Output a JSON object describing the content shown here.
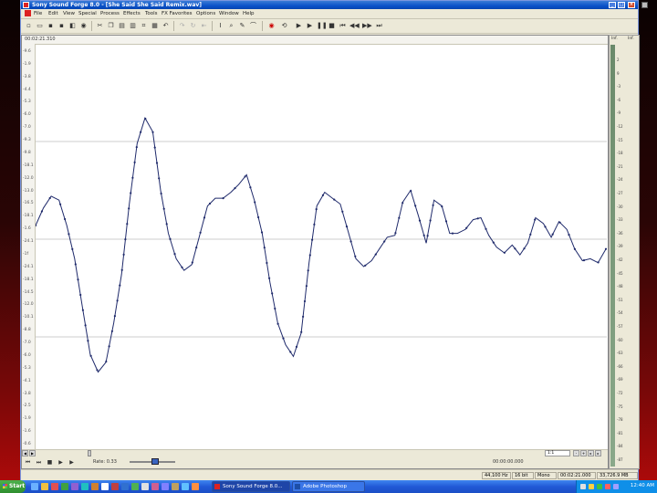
{
  "window": {
    "title": "Sony Sound Forge 8.0 - [She Said She Said Remix.wav]",
    "controls": [
      "_",
      "□",
      "×"
    ]
  },
  "menu": [
    "File",
    "Edit",
    "View",
    "Special",
    "Process",
    "Effects",
    "Tools",
    "FX Favorites",
    "Options",
    "Window",
    "Help"
  ],
  "toolbar_icons": [
    "new-icon",
    "open-icon",
    "save-icon",
    "save-as-icon",
    "render-icon",
    "properties-icon",
    "cut-icon",
    "copy-icon",
    "paste-icon",
    "mix-icon",
    "crop-icon",
    "clear-icon",
    "undo-icon",
    "redo-icon",
    "repeat-icon",
    "trim-icon",
    "edit-tool-icon",
    "magnify-tool-icon",
    "pencil-tool-icon",
    "envelope-tool-icon",
    "record-icon",
    "play-icon",
    "play-all-icon",
    "pause-icon",
    "stop-icon",
    "go-start-icon",
    "rewind-icon",
    "fast-forward-icon",
    "go-end-icon"
  ],
  "doc": {
    "ruler_time": "00:02:21.310",
    "axis_labels": [
      "-9.6",
      "-1.9",
      "-3.8",
      "-4.4",
      "-5.3",
      "-6.0",
      "-7.0",
      "-9.3",
      "-9.8",
      "-18.1",
      "-12.0",
      "-13.0",
      "-16.5",
      "-18.1",
      "-1.6",
      "-24.1",
      "-1f",
      "-24.1",
      "-18.1",
      "-14.5",
      "-12.0",
      "-10.1",
      "-8.8",
      "-7.0",
      "-6.0",
      "-5.3",
      "-4.1",
      "-3.8",
      "-2.5",
      "-1.9",
      "-1.6",
      "-0.6"
    ],
    "rate_label": "Rate: 0.33",
    "zoom_value": "1:1",
    "position": "00:00:00.000"
  },
  "waveform": {
    "samples": [
      0.07,
      0.16,
      0.22,
      0.2,
      0.07,
      -0.1,
      -0.35,
      -0.59,
      -0.68,
      -0.63,
      -0.43,
      -0.18,
      0.18,
      0.49,
      0.62,
      0.55,
      0.25,
      0.03,
      -0.1,
      -0.16,
      -0.13,
      0.02,
      0.17,
      0.21,
      0.21,
      0.24,
      0.28,
      0.33,
      0.2,
      0.03,
      -0.22,
      -0.43,
      -0.54,
      -0.6,
      -0.48,
      -0.12,
      0.17,
      0.24,
      0.21,
      0.18,
      0.04,
      -0.1,
      -0.14,
      -0.11,
      -0.05,
      0.01,
      0.02,
      0.19,
      0.25,
      0.12,
      -0.02,
      0.2,
      0.17,
      0.03,
      0.03,
      0.05,
      0.1,
      0.11,
      0.02,
      -0.04,
      -0.07,
      -0.03,
      -0.08,
      -0.02,
      0.11,
      0.08,
      0.01,
      0.09,
      0.05,
      -0.05,
      -0.11,
      -0.1,
      -0.12,
      -0.05
    ],
    "line_color": "#1f2a6b",
    "center_line_color": "#9a9a9a"
  },
  "meter": {
    "header_left": "Inf.",
    "header_right": "Inf.",
    "scale": [
      "2",
      "9",
      "-3",
      "-6",
      "-9",
      "-12",
      "-15",
      "-18",
      "-21",
      "-24",
      "-27",
      "-30",
      "-33",
      "-36",
      "-39",
      "-42",
      "-45",
      "-48",
      "-51",
      "-54",
      "-57",
      "-60",
      "-63",
      "-66",
      "-69",
      "-72",
      "-75",
      "-78",
      "-81",
      "-84",
      "-87"
    ]
  },
  "status": {
    "sample_rate": "44,100 Hz",
    "bit_depth": "16 bit",
    "channels": "Mono",
    "length": "00:02:21.000",
    "disk_space": "33,726.9 MB"
  },
  "taskbar": {
    "start_label": "Start",
    "tasks": [
      {
        "label": "Sony Sound Forge 8.0...",
        "active": true,
        "icon_color": "#d22"
      },
      {
        "label": "Adobe Photoshop",
        "active": false,
        "icon_color": "#1d4ea8"
      }
    ],
    "clock": "12:40 AM"
  },
  "colors": {
    "desktop_top": "#0a0202",
    "desktop_bottom": "#b20a0a",
    "titlebar": "#0a52c9"
  }
}
